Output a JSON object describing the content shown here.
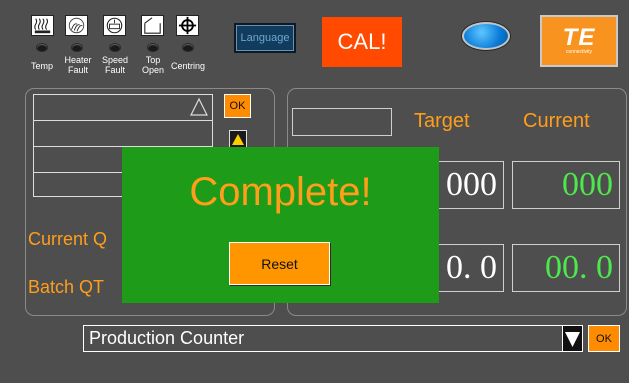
{
  "indicators": [
    {
      "label": "Temp",
      "icon": "heater-coil-icon"
    },
    {
      "label": "Heater\nFault",
      "icon": "heat-waves-icon"
    },
    {
      "label": "Speed\nFault",
      "icon": "speed-gauge-icon"
    },
    {
      "label": "Top\nOpen",
      "icon": "lid-open-icon"
    },
    {
      "label": "Centring",
      "icon": "crosshair-icon"
    }
  ],
  "header": {
    "language_label": "Language",
    "cal_label": "CAL!",
    "brand": "TE",
    "brand_sub": "connectivity"
  },
  "counter_panel": {
    "current_label": "Current Q",
    "batch_label": "Batch QT",
    "ok_label": "OK"
  },
  "values_panel": {
    "target_header": "Target",
    "current_header": "Current",
    "row1_target": "000",
    "row1_current": "000",
    "row2_target": "0. 0",
    "row2_current": "00. 0"
  },
  "popup": {
    "title": "Complete!",
    "reset_label": "Reset"
  },
  "footer": {
    "dropdown_value": "Production Counter",
    "ok_label": "OK"
  },
  "colors": {
    "background": "#4e4e4e",
    "accent_orange": "#ff9e1b",
    "popup_green": "#1d9b19",
    "value_green": "#4ce84c",
    "cal_red": "#ff4a00"
  }
}
